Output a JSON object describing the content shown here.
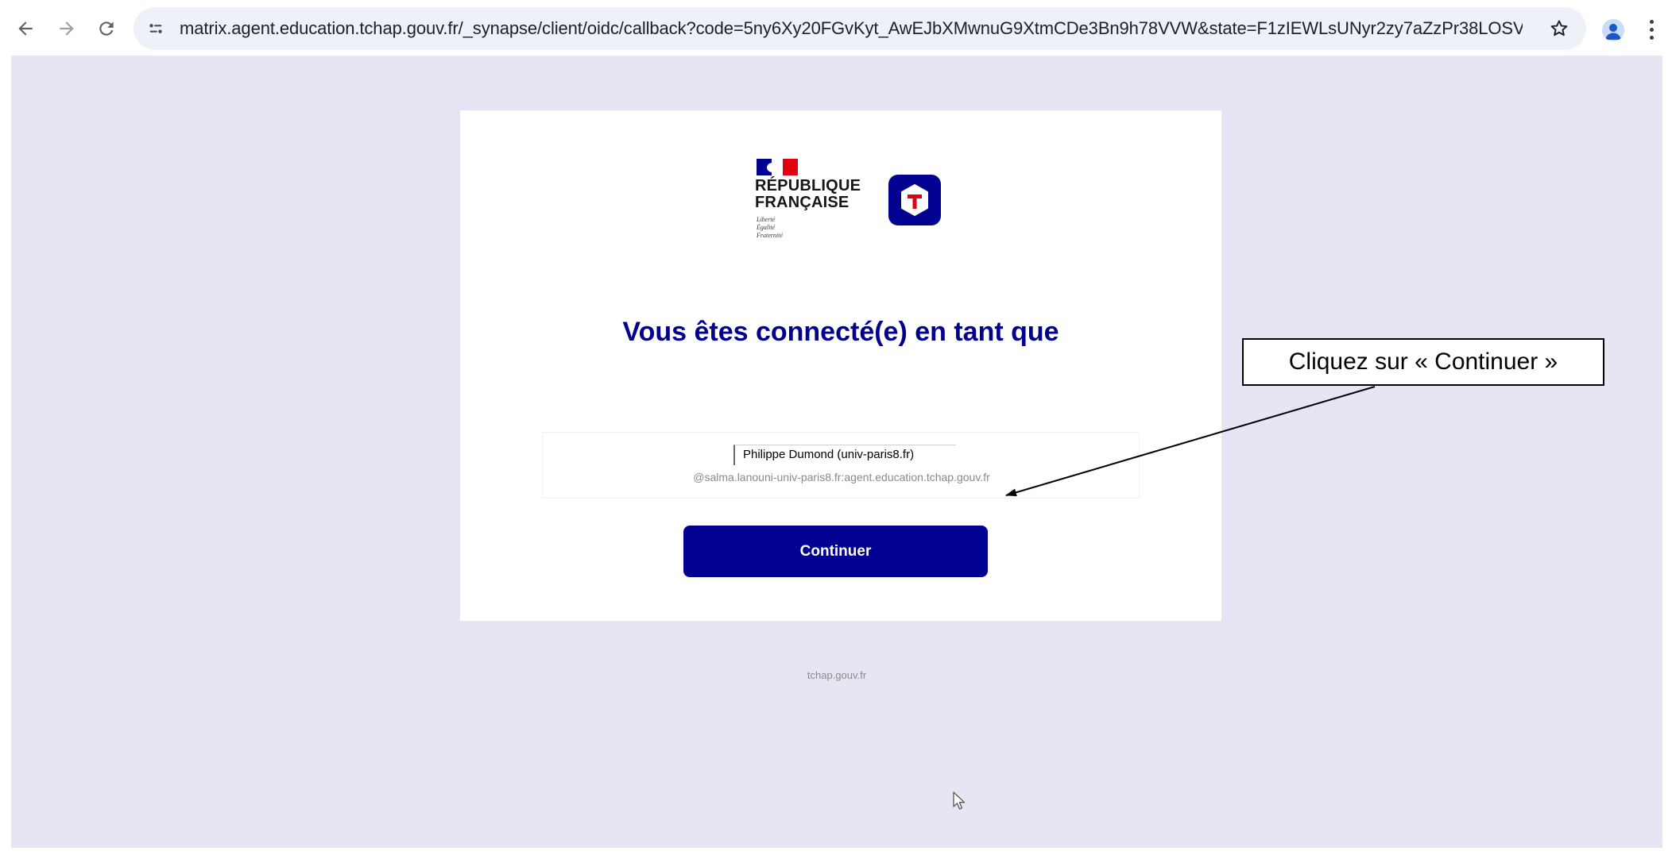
{
  "browser": {
    "url": "matrix.agent.education.tchap.gouv.fr/_synapse/client/oidc/callback?code=5ny6Xy20FGvKyt_AwEJbXMwnuG9XtmCDe3Bn9h78VVW&state=F1zIEWLsUNyr2zy7aZzPr38LOSVVTq&iss=https%3A%2F%2Faut..."
  },
  "logo": {
    "title_line1": "RÉPUBLIQUE",
    "title_line2": "FRANÇAISE",
    "motto_line1": "Liberté",
    "motto_line2": "Égalité",
    "motto_line3": "Fraternité",
    "brand_icon": "tchap-icon"
  },
  "page": {
    "heading": "Vous êtes connecté(e) en tant que",
    "display_name": "Philippe Dumond  (univ-paris8.fr)",
    "matrix_id": "@salma.lanouni-univ-paris8.fr:agent.education.tchap.gouv.fr",
    "continue_label": "Continuer",
    "footer": "tchap.gouv.fr"
  },
  "annotation": {
    "callout_text": "Cliquez sur « Continuer »"
  },
  "colors": {
    "accent": "#000091",
    "page_background": "#e5e5f3",
    "flag_red": "#e1000f"
  }
}
